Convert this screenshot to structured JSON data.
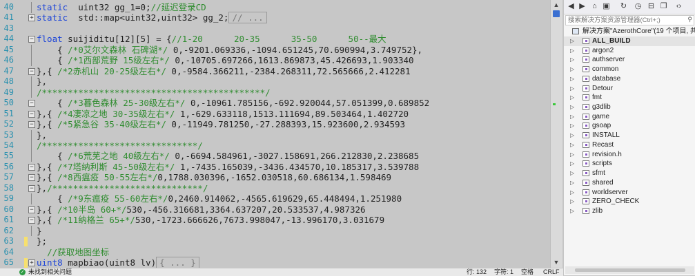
{
  "editor": {
    "lines": [
      {
        "num": "40",
        "segs": [
          {
            "t": "static  ",
            "c": "kw"
          },
          {
            "t": "uint32 gg_1=0;"
          },
          {
            "t": "//延迟登录CD",
            "c": "cm"
          }
        ],
        "guide": true
      },
      {
        "num": "41",
        "fold": "+",
        "segs": [
          {
            "t": "static  ",
            "c": "kw"
          },
          {
            "t": "std::map<uint32,uint32> gg_2;"
          },
          {
            "t": "// ...",
            "c": "collapsed"
          }
        ]
      },
      {
        "num": "43",
        "segs": []
      },
      {
        "num": "44",
        "fold": "-",
        "segs": [
          {
            "t": "float ",
            "c": "kw"
          },
          {
            "t": "suijiditu[12][5] = {"
          },
          {
            "t": "//1-20      20-35      35-50      50--最大",
            "c": "cm"
          }
        ]
      },
      {
        "num": "45",
        "guide": true,
        "segs": [
          {
            "t": "    { "
          },
          {
            "t": "/*0艾尔文森林 石碑湖*/",
            "c": "cm"
          },
          {
            "t": " 0,-9201.069336,-1094.651245,70.690994,3.749752},"
          }
        ]
      },
      {
        "num": "46",
        "guide": true,
        "segs": [
          {
            "t": "    { "
          },
          {
            "t": "/*1西部荒野 15级左右*/",
            "c": "cm"
          },
          {
            "t": " 0,-10705.697266,1613.869873,45.426693,1.903340"
          }
        ]
      },
      {
        "num": "47",
        "fold": "-",
        "segs": [
          {
            "t": "},{ "
          },
          {
            "t": "/*2赤机山 20-25级左右*/",
            "c": "cm"
          },
          {
            "t": " 0,-9584.366211,-2384.268311,72.565666,2.412281"
          }
        ]
      },
      {
        "num": "48",
        "guide": true,
        "segs": [
          {
            "t": "},"
          }
        ]
      },
      {
        "num": "49",
        "guide": true,
        "segs": [
          {
            "t": "/*******************************************/",
            "c": "cm"
          }
        ]
      },
      {
        "num": "50",
        "fold": "-",
        "segs": [
          {
            "t": "    { "
          },
          {
            "t": "/*3暮色森林 25-30级左右*/",
            "c": "cm"
          },
          {
            "t": " 0,-10961.785156,-692.920044,57.051399,0.689852"
          }
        ]
      },
      {
        "num": "51",
        "fold": "-",
        "segs": [
          {
            "t": "},{ "
          },
          {
            "t": "/*4凄凉之地 30-35级左右*/",
            "c": "cm"
          },
          {
            "t": " 1,-629.633118,1513.111694,89.503464,1.402720"
          }
        ]
      },
      {
        "num": "52",
        "fold": "-",
        "segs": [
          {
            "t": "},{ "
          },
          {
            "t": "/*5紧急谷 35-40级左右*/",
            "c": "cm"
          },
          {
            "t": " 0,-11949.781250,-27.288393,15.923600,2.934593"
          }
        ]
      },
      {
        "num": "53",
        "guide": true,
        "segs": [
          {
            "t": "},"
          }
        ]
      },
      {
        "num": "54",
        "guide": true,
        "segs": [
          {
            "t": "/******************************/",
            "c": "cm"
          }
        ]
      },
      {
        "num": "55",
        "guide": true,
        "segs": [
          {
            "t": "    { "
          },
          {
            "t": "/*6荒芜之地 40级左右*/",
            "c": "cm"
          },
          {
            "t": " 0,-6694.584961,-3027.158691,266.212830,2.238685"
          }
        ]
      },
      {
        "num": "56",
        "fold": "-",
        "segs": [
          {
            "t": "},{ "
          },
          {
            "t": "/*7塔纳利斯 45-50级左右*/",
            "c": "cm"
          },
          {
            "t": " 1,-7435.165039,-3436.434570,10.185317,3.539788"
          }
        ]
      },
      {
        "num": "57",
        "fold": "-",
        "segs": [
          {
            "t": "},{ "
          },
          {
            "t": "/*8西瘟疫 50-55左右*/",
            "c": "cm"
          },
          {
            "t": "0,1788.030396,-1652.030518,60.686134,1.598469"
          }
        ]
      },
      {
        "num": "58",
        "fold": "-",
        "segs": [
          {
            "t": "},"
          },
          {
            "t": "/*****************************/",
            "c": "cm"
          }
        ]
      },
      {
        "num": "59",
        "guide": true,
        "segs": [
          {
            "t": "    { "
          },
          {
            "t": "/*9东瘟疫 55-60左右*/",
            "c": "cm"
          },
          {
            "t": "0,2460.914062,-4565.619629,65.448494,1.251980"
          }
        ]
      },
      {
        "num": "60",
        "fold": "-",
        "segs": [
          {
            "t": "},{ "
          },
          {
            "t": "/*10半岛 60+*/",
            "c": "cm"
          },
          {
            "t": "530,-456.316681,3364.637207,20.533537,4.987326"
          }
        ]
      },
      {
        "num": "61",
        "fold": "-",
        "segs": [
          {
            "t": "},{ "
          },
          {
            "t": "/*11纳格兰 65+*/",
            "c": "cm"
          },
          {
            "t": "530,-1723.666626,7673.998047,-13.996170,3.031679"
          }
        ]
      },
      {
        "num": "62",
        "guide": true,
        "segs": [
          {
            "t": "}"
          }
        ]
      },
      {
        "num": "63",
        "change": true,
        "segs": [
          {
            "t": "};"
          }
        ]
      },
      {
        "num": "64",
        "segs": [
          {
            "t": "  "
          },
          {
            "t": "//获取地图坐标",
            "c": "cm"
          }
        ]
      },
      {
        "num": "65",
        "change": true,
        "fold": "+",
        "segs": [
          {
            "t": "uint8 ",
            "c": "kw"
          },
          {
            "t": "mapbiao(uint8 lv)"
          },
          {
            "t": "{ ... }",
            "c": "collapsed"
          }
        ]
      }
    ]
  },
  "status": {
    "icon": "check-circle-icon",
    "message": "未找到相关问题",
    "line": "行: 132",
    "char": "字符: 1",
    "whitespace": "空格",
    "eol": "CRLF"
  },
  "solution_explorer": {
    "search_placeholder": "搜索解决方案资源管理器(Ctrl+;)",
    "solution_label": "解决方案\"AzerothCore\"(19 个项目, 共",
    "items": [
      {
        "label": "ALL_BUILD",
        "bold": true,
        "selected": true
      },
      {
        "label": "argon2"
      },
      {
        "label": "authserver"
      },
      {
        "label": "common"
      },
      {
        "label": "database"
      },
      {
        "label": "Detour"
      },
      {
        "label": "fmt"
      },
      {
        "label": "g3dlib"
      },
      {
        "label": "game"
      },
      {
        "label": "gsoap"
      },
      {
        "label": "INSTALL"
      },
      {
        "label": "Recast"
      },
      {
        "label": "revision.h"
      },
      {
        "label": "scripts"
      },
      {
        "label": "sfmt"
      },
      {
        "label": "shared"
      },
      {
        "label": "worldserver"
      },
      {
        "label": "ZERO_CHECK"
      },
      {
        "label": "zlib"
      }
    ],
    "toolbar_icons": [
      "back-icon",
      "forward-icon",
      "home-icon",
      "solution-icon",
      "sync-icon",
      "history-icon",
      "collapse-icon",
      "show-all-icon",
      "code-icon"
    ]
  },
  "colors": {
    "editor_bg": "#c7c7c7",
    "keyword": "#1b43d8",
    "comment": "#2f8c2f",
    "line_number": "#2b91af",
    "change_marker": "#f7e06e"
  }
}
